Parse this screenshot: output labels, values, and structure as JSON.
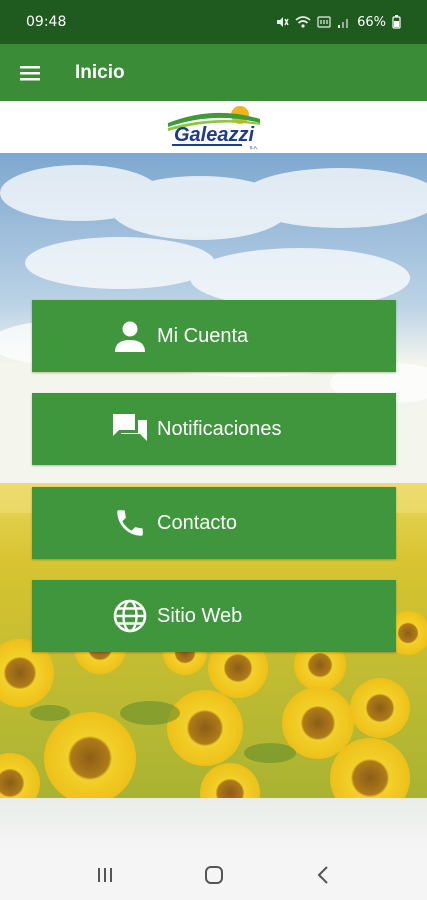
{
  "status_bar": {
    "time": "09:48",
    "battery": "66%",
    "icons": [
      "mute-icon",
      "wifi-icon",
      "volte-icon",
      "signal-icon",
      "battery-icon"
    ]
  },
  "app_bar": {
    "title": "Inicio",
    "menu_icon": "hamburger-menu-icon"
  },
  "logo": {
    "brand": "Galeazzi",
    "suffix": "S.A."
  },
  "menu": [
    {
      "label": "Mi Cuenta",
      "icon": "person-icon"
    },
    {
      "label": "Notificaciones",
      "icon": "chat-bubbles-icon"
    },
    {
      "label": "Contacto",
      "icon": "phone-icon"
    },
    {
      "label": "Sitio Web",
      "icon": "globe-icon"
    }
  ],
  "nav_bar": {
    "icons": [
      "recent-apps-icon",
      "home-icon",
      "back-icon"
    ]
  },
  "colors": {
    "status_bar": "#1f5a1f",
    "app_bar": "#3a8d36",
    "button": "#3f963c"
  }
}
